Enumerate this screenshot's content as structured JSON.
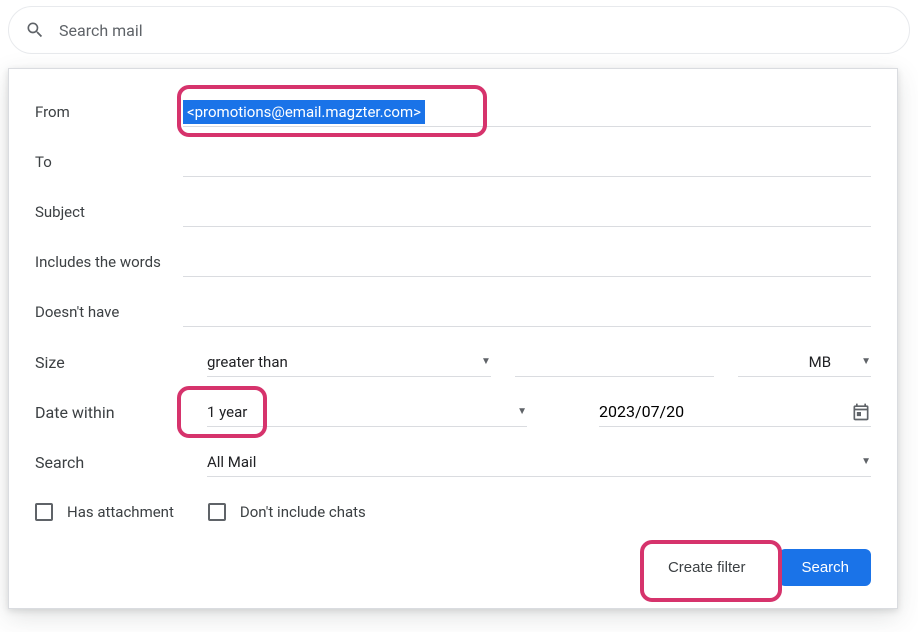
{
  "search": {
    "placeholder": "Search mail"
  },
  "labels": {
    "from": "From",
    "to": "To",
    "subject": "Subject",
    "includes": "Includes the words",
    "doesnt": "Doesn't have",
    "size": "Size",
    "datewithin": "Date within",
    "search": "Search"
  },
  "values": {
    "from": "<promotions@email.magzter.com>",
    "size_op": "greater than",
    "size_unit": "MB",
    "date_range": "1 year",
    "date_value": "2023/07/20",
    "search_scope": "All Mail"
  },
  "checkboxes": {
    "has_attachment": "Has attachment",
    "no_chats": "Don't include chats"
  },
  "buttons": {
    "create_filter": "Create filter",
    "search": "Search"
  }
}
